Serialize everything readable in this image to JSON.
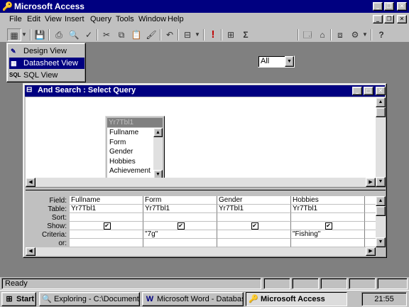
{
  "app": {
    "title": "Microsoft Access",
    "controls": {
      "minimize": "_",
      "restore": "❐",
      "close": "✕"
    }
  },
  "menu": [
    "File",
    "Edit",
    "View",
    "Insert",
    "Query",
    "Tools",
    "Window",
    "Help"
  ],
  "toolbar": {
    "filter_value": "All",
    "sigma": "Σ",
    "exclaim": "!"
  },
  "view_menu": {
    "items": [
      {
        "label": "Design View",
        "icon": "design-view-icon"
      },
      {
        "label": "Datasheet View",
        "icon": "datasheet-view-icon",
        "selected": true
      },
      {
        "label": "SQL View",
        "icon": "sql-view-icon",
        "icon_text": "SQL"
      }
    ]
  },
  "query_window": {
    "title": "And Search : Select Query",
    "table": {
      "name": "Yr7Tbl1",
      "fields": [
        "Fullname",
        "Form",
        "Gender",
        "Hobbies",
        "Achievement"
      ]
    },
    "row_labels": [
      "Field:",
      "Table:",
      "Sort:",
      "Show:",
      "Criteria:",
      "or:"
    ],
    "columns": [
      {
        "field": "Fullname",
        "table": "Yr7Tbl1",
        "sort": "",
        "show": true,
        "criteria": "",
        "or": ""
      },
      {
        "field": "Form",
        "table": "Yr7Tbl1",
        "sort": "",
        "show": true,
        "criteria": "\"7g\"",
        "or": ""
      },
      {
        "field": "Gender",
        "table": "Yr7Tbl1",
        "sort": "",
        "show": true,
        "criteria": "",
        "or": ""
      },
      {
        "field": "Hobbies",
        "table": "Yr7Tbl1",
        "sort": "",
        "show": true,
        "criteria": "\"Fishing\"",
        "or": ""
      }
    ]
  },
  "status": {
    "text": "Ready"
  },
  "taskbar": {
    "start": "Start",
    "tasks": [
      "Exploring - C:\\Documents",
      "Microsoft Word - Database...",
      "Microsoft Access"
    ],
    "time": "21:55"
  }
}
